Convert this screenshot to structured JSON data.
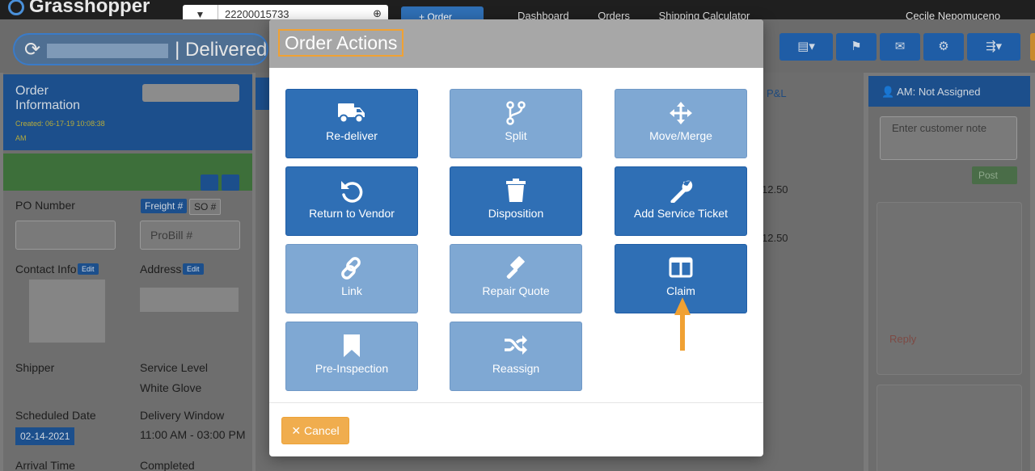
{
  "topnav": {
    "brand": "Grasshopper",
    "search_value": "22200015733",
    "order_button": "+ Order",
    "links": [
      "Dashboard",
      "Orders",
      "Shipping Calculator"
    ],
    "user": "Cecile Nepomuceno"
  },
  "titlebar": {
    "status": "| Delivered"
  },
  "order_info": {
    "title": "Order Information",
    "created": "Created: 06-17-19 10:08:38 AM",
    "po_label": "PO Number",
    "freight_tag": "Freight #",
    "so_tag": "SO #",
    "probill_placeholder": "ProBill #",
    "contact_label": "Contact Info",
    "address_label": "Address",
    "edit_label": "Edit",
    "shipper_label": "Shipper",
    "service_level_label": "Service Level",
    "service_level_value": "White Glove",
    "scheduled_date_label": "Scheduled Date",
    "scheduled_date_value": "02-14-2021",
    "delivery_window_label": "Delivery Window",
    "delivery_window_value": "11:00 AM - 03:00 PM",
    "arrival_time_label": "Arrival Time",
    "completed_label": "Completed"
  },
  "middle": {
    "pl_tab": "P&L",
    "row_values": [
      "12.50",
      "12.50"
    ]
  },
  "right_panel": {
    "am_label": "AM: Not Assigned",
    "note_placeholder": "Enter customer note",
    "post_label": "Post",
    "reply_label": "Reply"
  },
  "modal": {
    "title": "Order Actions",
    "actions": [
      {
        "label": "Re-deliver",
        "icon": "truck-icon",
        "style": "dark"
      },
      {
        "label": "Split",
        "icon": "code-branch-icon",
        "style": "light"
      },
      {
        "label": "Move/Merge",
        "icon": "arrows-move-icon",
        "style": "light"
      },
      {
        "label": "Return to Vendor",
        "icon": "undo-icon",
        "style": "dark"
      },
      {
        "label": "Disposition",
        "icon": "trash-icon",
        "style": "dark"
      },
      {
        "label": "Add Service Ticket",
        "icon": "wrench-icon",
        "style": "dark"
      },
      {
        "label": "Link",
        "icon": "link-icon",
        "style": "light"
      },
      {
        "label": "Repair Quote",
        "icon": "gavel-icon",
        "style": "light"
      },
      {
        "label": "Claim",
        "icon": "columns-icon",
        "style": "dark"
      },
      {
        "label": "Pre-Inspection",
        "icon": "bookmark-icon",
        "style": "light"
      },
      {
        "label": "Reassign",
        "icon": "shuffle-icon",
        "style": "light"
      }
    ],
    "cancel_label": "Cancel"
  },
  "colors": {
    "action_dark": "#2f6fb5",
    "action_light": "#7fa8d3",
    "cancel": "#f0ad4e",
    "highlight": "#f0a133"
  }
}
